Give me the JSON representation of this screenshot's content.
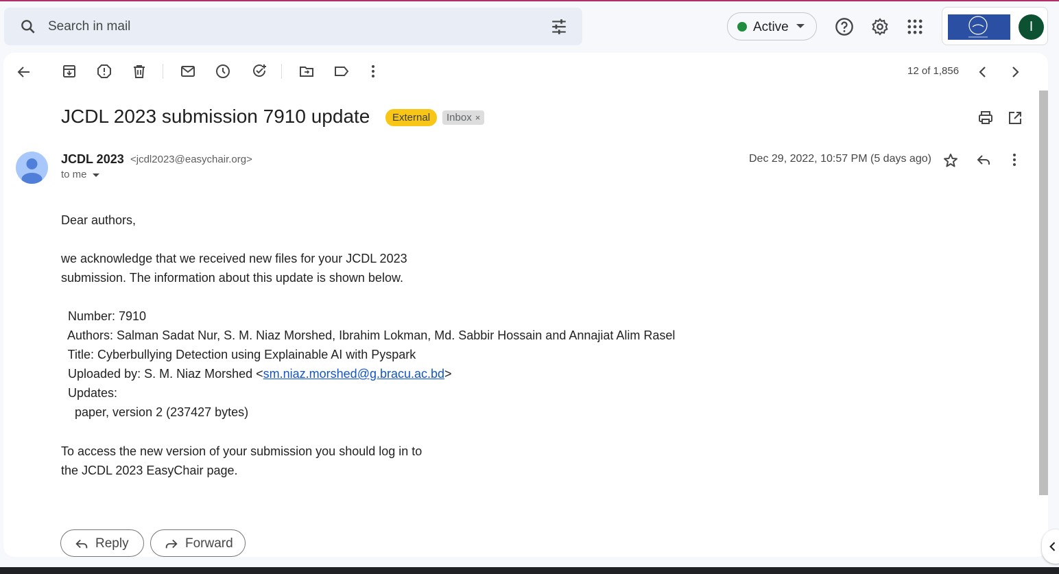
{
  "search": {
    "placeholder": "Search in mail"
  },
  "status": {
    "label": "Active",
    "color": "#1e8e3e"
  },
  "account": {
    "avatar_letter": "I",
    "avatar_color": "#0b5132"
  },
  "toolbar": {
    "page_count": "12 of 1,856"
  },
  "message": {
    "subject": "JCDL 2023 submission 7910 update",
    "labels": {
      "external": "External",
      "inbox": "Inbox",
      "inbox_remove": "×"
    },
    "sender_name": "JCDL 2023",
    "sender_email": "<jcdl2023@easychair.org>",
    "to": "to me",
    "date": "Dec 29, 2022, 10:57 PM (5 days ago)",
    "body": {
      "greeting": "Dear authors,",
      "p1_l1": "we acknowledge that we received new files for your JCDL 2023",
      "p1_l2": "submission. The information about this update is shown below.",
      "number": "  Number: 7910",
      "authors": "  Authors: Salman Sadat Nur, S. M. Niaz Morshed, Ibrahim Lokman, Md. Sabbir Hossain and Annajiat Alim Rasel",
      "title": "  Title: Cyberbullying Detection using Explainable AI with Pyspark",
      "uploaded_prefix": "  Uploaded by: S. M. Niaz Morshed <",
      "uploaded_email": "sm.niaz.morshed@g.bracu.ac.bd",
      "uploaded_suffix": ">",
      "updates": "  Updates:",
      "paper": "    paper, version 2 (237427 bytes)",
      "p2_l1": "To access the new version of your submission you should log in to",
      "p2_l2": "the JCDL 2023 EasyChair page."
    }
  },
  "actions": {
    "reply": "Reply",
    "forward": "Forward"
  },
  "icons": [
    "search-icon",
    "tune-icon",
    "help-icon",
    "gear-icon",
    "apps-icon",
    "back-arrow-icon",
    "archive-icon",
    "report-spam-icon",
    "delete-icon",
    "mark-unread-icon",
    "snooze-icon",
    "add-task-icon",
    "move-to-icon",
    "label-icon",
    "more-vert-icon",
    "chevron-left-icon",
    "chevron-right-icon",
    "print-icon",
    "open-in-new-icon",
    "star-icon",
    "reply-icon",
    "forward-icon"
  ]
}
